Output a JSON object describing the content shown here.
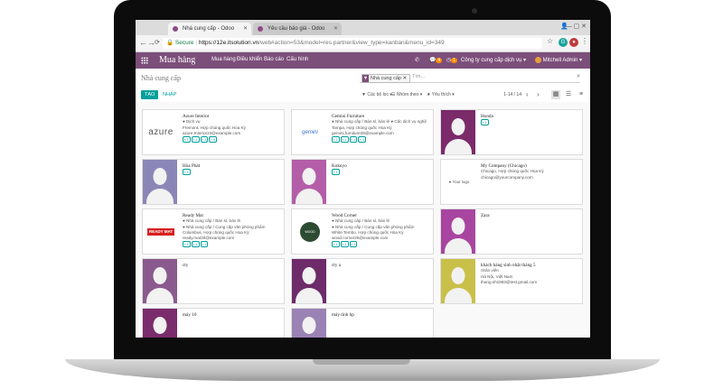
{
  "browser": {
    "tabs": [
      {
        "title": "Nhà cung cấp - Odoo",
        "active": true
      },
      {
        "title": "Yêu cầu báo giá - Odoo",
        "active": false
      }
    ],
    "secure_label": "Secure",
    "url_host": "https://12e.itsolution.vn",
    "url_rest": "/web#action=53&model=res.partner&view_type=kanban&menu_id=349"
  },
  "topbar": {
    "brand": "Mua hàng",
    "menus": [
      "Mua hàng",
      "Điều khiển",
      "Báo cáo",
      "Cấu hình"
    ],
    "company": "Công ty cung cấp dịch vụ",
    "user": "Mitchell Admin",
    "chat_count": "4",
    "activity_count": "1"
  },
  "control": {
    "breadcrumb": "Nhà cung cấp",
    "facet": "Nhà cung cấp",
    "search_placeholder": "Tìm...",
    "create_label": "TẠO",
    "import_label": "NHẬP",
    "filters_label": "Các bộ lọc",
    "groupby_label": "Nhóm theo",
    "favorites_label": "Yêu thích",
    "pager": "1-14 / 14"
  },
  "colors": {
    "brand": "#7c4f7b",
    "accent": "#00a09d"
  },
  "cards": [
    {
      "name": "Azure Interior",
      "logo": "azure",
      "lines": [
        "● Dịch vụ",
        "Fremont, Hợp chủng quốc Hoa Kỳ",
        "azure.Interior24@example.com"
      ],
      "tags": [
        "1",
        "1",
        "1",
        "5"
      ]
    },
    {
      "name": "Gemini Furniture",
      "logo": "gemini",
      "lines": [
        "● Nhà cung cấp / Bán sỉ, bán lẻ  ● Cấc dịch vụ nghệ",
        "Tampa, Hợp chủng quốc Hoa Kỳ",
        "gemini.furniture39@example.com"
      ],
      "tags": [
        "1",
        "1",
        "1",
        "1"
      ]
    },
    {
      "name": "Honda",
      "logo": "person",
      "bg": "#7b2a6a",
      "lines": [],
      "tags": [
        "1"
      ]
    },
    {
      "name": "Hòa Phát",
      "logo": "person",
      "bg": "#8a87b8",
      "lines": [],
      "tags": [
        "1"
      ]
    },
    {
      "name": "Kokuyo",
      "logo": "person",
      "bg": "#b45ea9",
      "lines": [],
      "tags": [
        "1"
      ]
    },
    {
      "name": "My Company (Chicago)",
      "logo": "yourlogo",
      "lines": [
        "Chicago, Hợp chủng quốc Hoa Kỳ",
        "chicago@yourcompany.com"
      ],
      "tags": []
    },
    {
      "name": "Ready Mat",
      "logo": "readymat",
      "lines": [
        "● Nhà cung cấp / Bán sỉ, bán lẻ",
        "● Nhà cung cấp / Cung cấp văn phòng phẩm",
        "Columbus, Hợp chủng quốc Hoa Kỳ",
        "ready.mat28@example.com"
      ],
      "tags": [
        "1",
        "1",
        "1"
      ]
    },
    {
      "name": "Wood Corner",
      "logo": "wood",
      "lines": [
        "● Nhà cung cấp / Bán sỉ, bán lẻ",
        "● Nhà cung cấp / Cung cấp văn phòng phẩm",
        "White Tembo, Hợp chủng quốc Hoa Kỳ",
        "wood.corner26@example.com"
      ],
      "tags": [
        "1",
        "1",
        "1"
      ]
    },
    {
      "name": "Zara",
      "logo": "person",
      "bg": "#a845a0",
      "lines": [],
      "tags": []
    },
    {
      "name": "cty",
      "logo": "person",
      "bg": "#8a5a8e",
      "lines": [],
      "tags": []
    },
    {
      "name": "cty a",
      "logo": "person",
      "bg": "#6d2b6a",
      "lines": [],
      "tags": []
    },
    {
      "name": "khách hàng sinh nhật tháng 5",
      "logo": "person",
      "bg": "#c9c04a",
      "lines": [
        "nhân viên",
        "Hà Nội, Việt Nam",
        "thang.sh1993@test.gmail.com"
      ],
      "tags": []
    },
    {
      "name": "máy 10",
      "logo": "person",
      "bg": "#7a2c6c",
      "lines": [],
      "tags": []
    },
    {
      "name": "máy tính hp",
      "logo": "person",
      "bg": "#9b82b4",
      "lines": [],
      "tags": []
    }
  ]
}
